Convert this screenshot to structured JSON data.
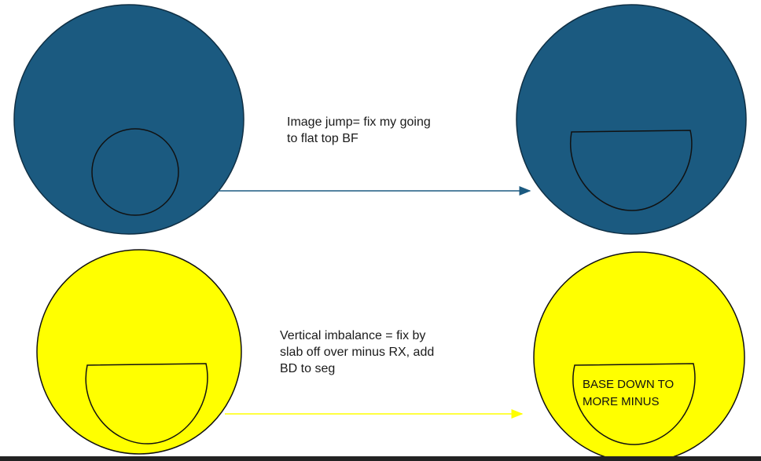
{
  "colors": {
    "blue_fill": "#1b5a80",
    "yellow_fill": "#ffff00",
    "outline": "#111111",
    "arrow_top": "#1b5a80",
    "arrow_bottom": "#ffff00"
  },
  "top_row": {
    "note": "Image jump= fix my going\nto flat top BF"
  },
  "bottom_row": {
    "note": "Vertical imbalance = fix by\nslab off over minus RX, add\nBD to seg",
    "segment_label": "BASE DOWN TO\nMORE MINUS"
  }
}
